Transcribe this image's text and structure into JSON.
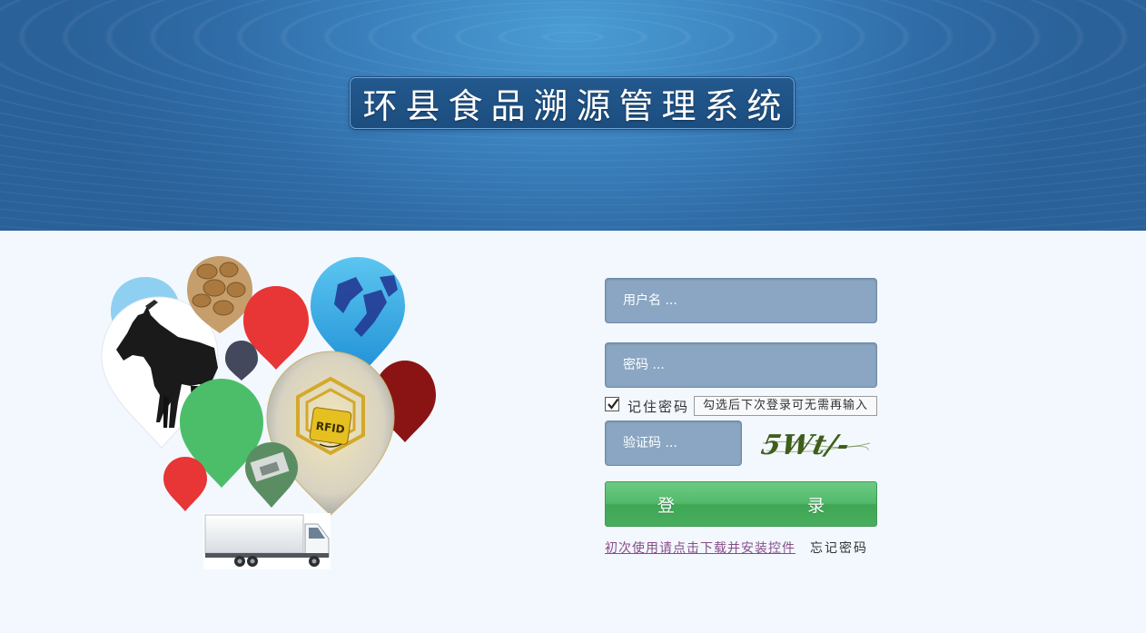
{
  "header": {
    "title": "环县食品溯源管理系统"
  },
  "illustration": {
    "rfid_label": "RFID"
  },
  "login_form": {
    "username_placeholder": "用户名 ...",
    "password_placeholder": "密码 ...",
    "remember_label": "记住密码",
    "remember_checked": true,
    "remember_tip": "勾选后下次登录可无需再输入",
    "captcha_placeholder": "验证码 ...",
    "captcha_image_text": "5Wt/-",
    "login_button_label": "登　　录",
    "download_link": "初次使用请点击下载并安装控件",
    "forgot_password": "忘记密码"
  },
  "colors": {
    "header_blue": "#2f6ba6",
    "field_bg": "#8aa6c2",
    "login_green": "#4fb466",
    "download_link": "#8a4b8a"
  }
}
